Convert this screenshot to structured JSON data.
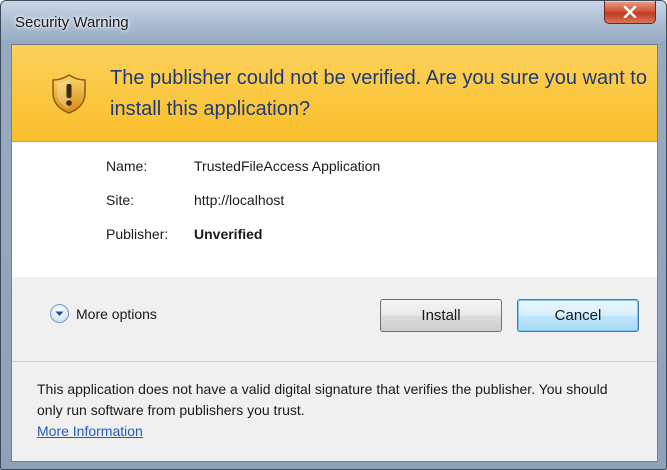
{
  "window": {
    "title": "Security Warning",
    "close_icon": "close-icon"
  },
  "banner": {
    "icon": "shield-warning-icon",
    "headline": "The publisher could not be verified. Are you sure you want to install this application?",
    "background_color": "#F9C230",
    "text_color": "#1F3A78"
  },
  "details": {
    "name": {
      "label": "Name:",
      "value": "TrustedFileAccess Application"
    },
    "site": {
      "label": "Site:",
      "value": "http://localhost"
    },
    "publisher": {
      "label": "Publisher:",
      "value": "Unverified"
    }
  },
  "options": {
    "more_options_label": "More options",
    "expand_icon": "chevron-down-circle-icon"
  },
  "buttons": {
    "install_label": "Install",
    "cancel_label": "Cancel"
  },
  "footer": {
    "text": "This application does not have a valid digital signature that verifies the publisher. You should only run software from publishers you trust.",
    "more_info_link": "More Information"
  }
}
